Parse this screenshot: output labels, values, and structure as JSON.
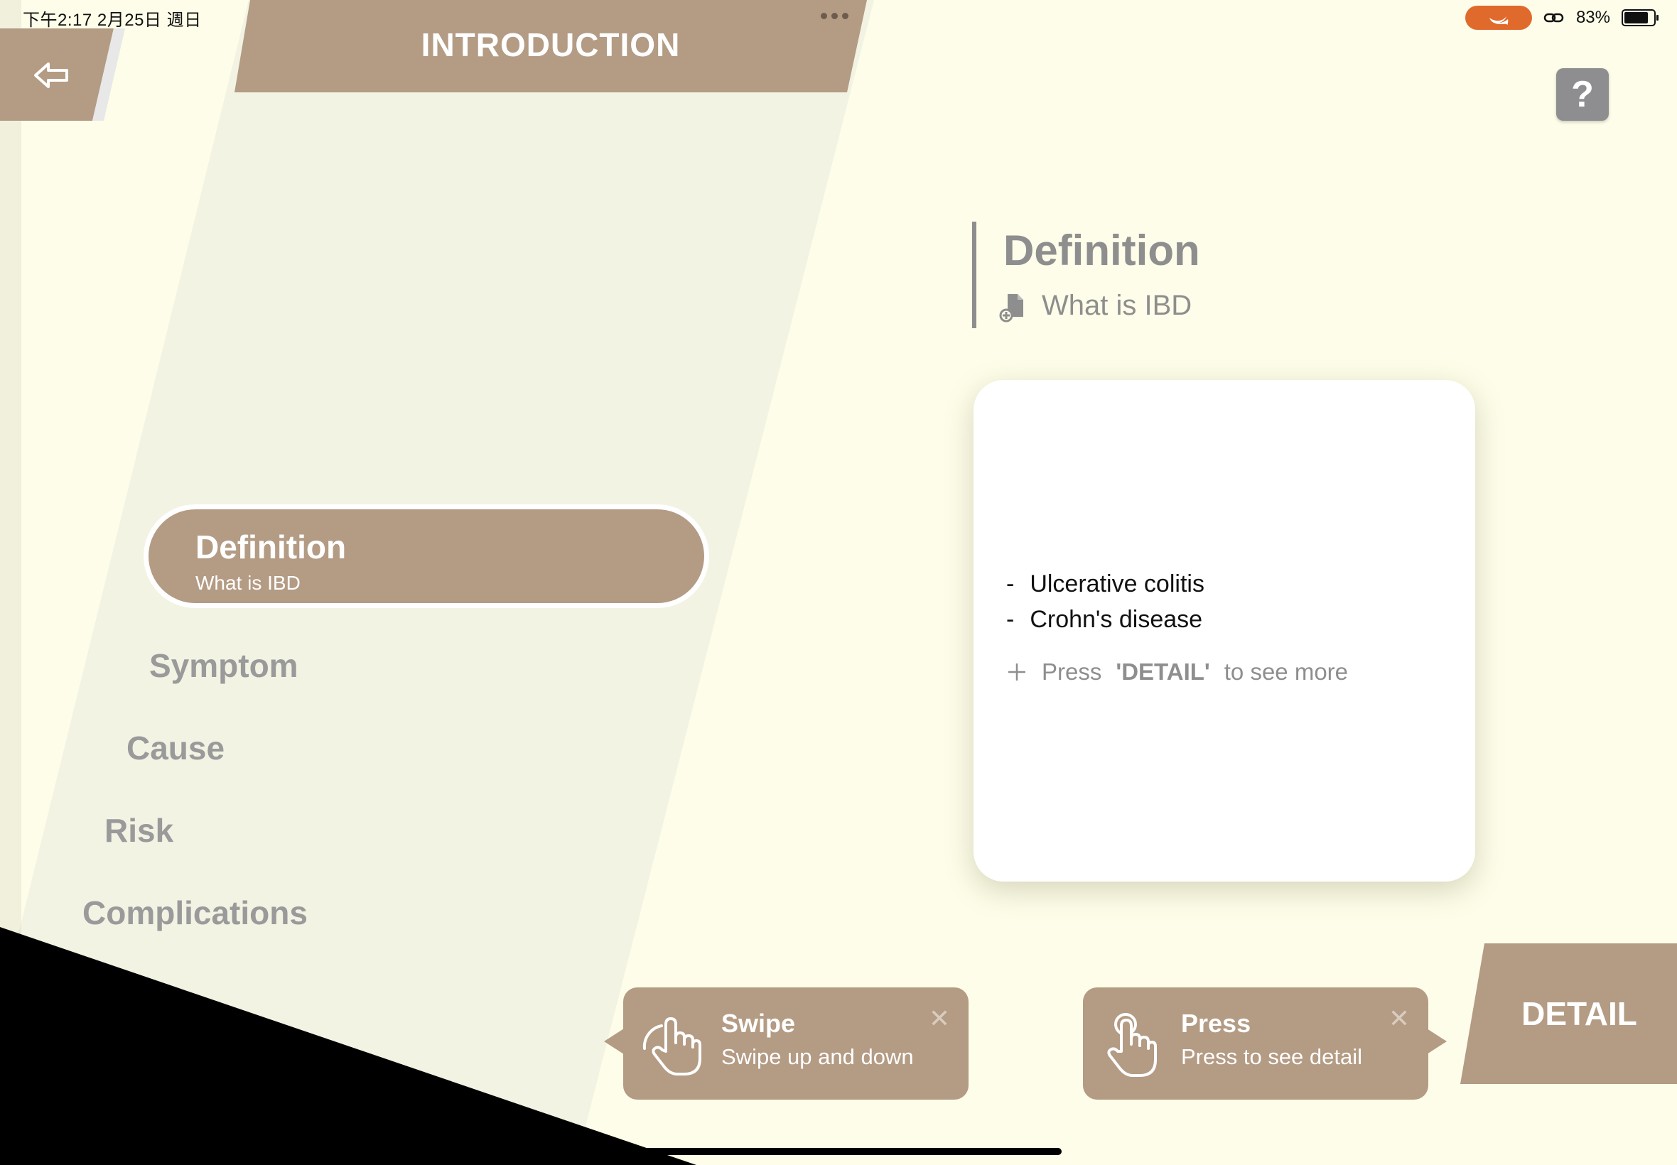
{
  "status_bar": {
    "time_date": "下午2:17   2月25日 週日",
    "battery_pct": "83%",
    "battery_level": 0.83
  },
  "header": {
    "title": "INTRODUCTION",
    "help_label": "?"
  },
  "sidebar": {
    "selected": {
      "title": "Definition",
      "subtitle": "What is IBD"
    },
    "items": [
      {
        "label": "Symptom"
      },
      {
        "label": "Cause"
      },
      {
        "label": "Risk"
      },
      {
        "label": "Complications"
      }
    ]
  },
  "content": {
    "title": "Definition",
    "subtitle": "What is IBD",
    "bullets": [
      {
        "dash": "-",
        "text": "Ulcerative colitis"
      },
      {
        "dash": "-",
        "text": "Crohn's disease"
      }
    ],
    "hint": {
      "prefix": "Press",
      "keyword": "'DETAIL'",
      "suffix": "to see more"
    }
  },
  "toasts": {
    "swipe": {
      "title": "Swipe",
      "subtitle": "Swipe up and down"
    },
    "press": {
      "title": "Press",
      "subtitle": "Press to see detail"
    }
  },
  "detail_button": {
    "label": "DETAIL"
  },
  "colors": {
    "accent": "#b49b84",
    "background": "#fdfde9",
    "panel": "#f2f3e3",
    "swift_badge": "#e06a2c"
  },
  "icons": {
    "back": "arrow-left-icon",
    "help": "question-icon",
    "document": "document-plus-icon",
    "hand_swipe": "hand-swipe-icon",
    "hand_press": "hand-press-icon",
    "close": "close-icon",
    "plus": "plus-icon"
  }
}
